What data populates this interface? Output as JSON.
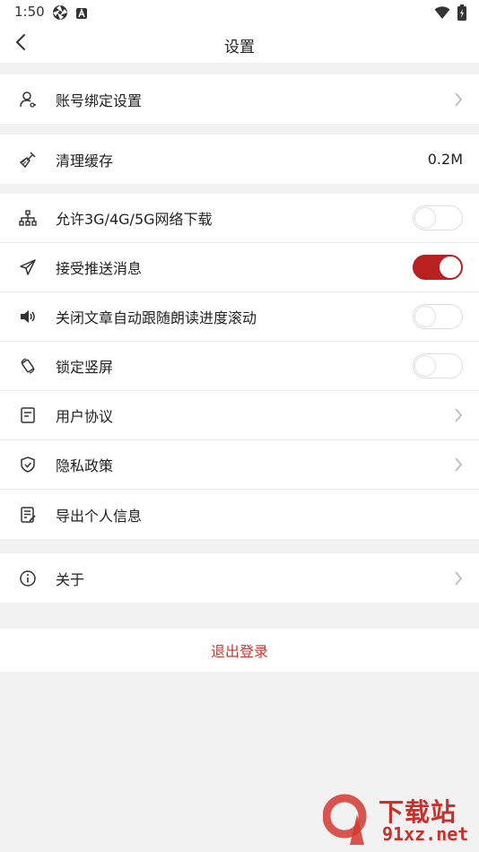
{
  "status": {
    "time": "1:50"
  },
  "nav": {
    "title": "设置"
  },
  "account": {
    "label": "账号绑定设置"
  },
  "cache": {
    "label": "清理缓存",
    "value": "0.2M"
  },
  "settings": [
    {
      "label": "允许3G/4G/5G网络下载",
      "on": false
    },
    {
      "label": "接受推送消息",
      "on": true
    },
    {
      "label": "关闭文章自动跟随朗读进度滚动",
      "on": false
    },
    {
      "label": "锁定竖屏",
      "on": false
    },
    {
      "label": "用户协议"
    },
    {
      "label": "隐私政策"
    },
    {
      "label": "导出个人信息"
    }
  ],
  "about": {
    "label": "关于"
  },
  "logout": {
    "label": "退出登录"
  },
  "watermark": {
    "line1": "下载站",
    "line2": "91xz.net"
  },
  "colors": {
    "accent": "#b8211f",
    "logout": "#d2342c"
  }
}
